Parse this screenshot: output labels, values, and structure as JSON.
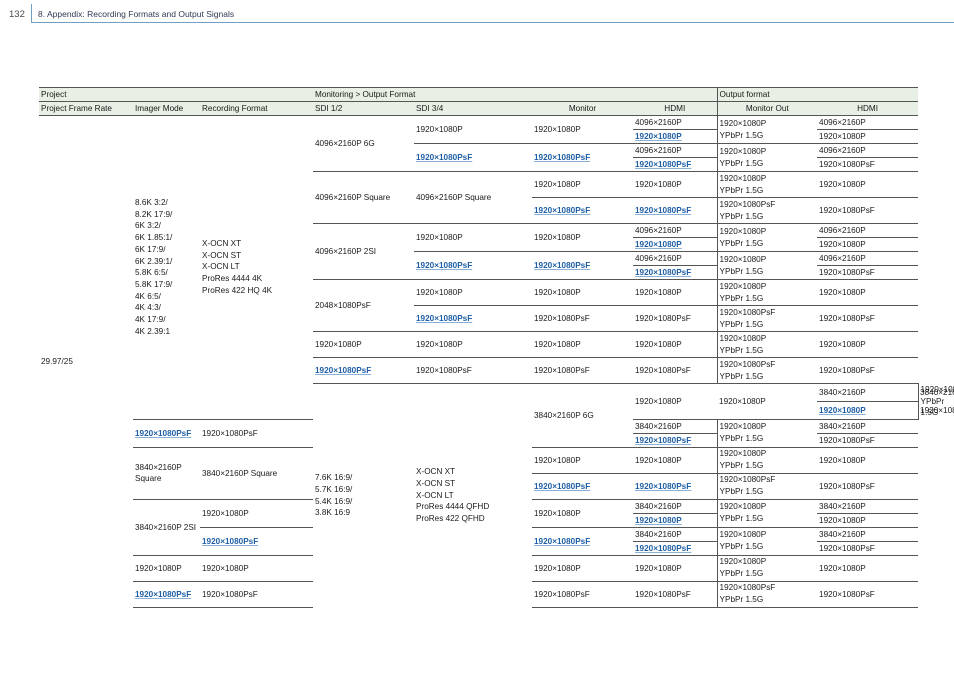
{
  "page_number": "132",
  "section_title": "8. Appendix: Recording Formats and Output Signals",
  "table": {
    "group_headers": {
      "project": "Project",
      "monitoring": "Monitoring > Output Format",
      "output_format": "Output format"
    },
    "columns": {
      "frame_rate": "Project Frame Rate",
      "imager_mode": "Imager Mode",
      "recording_format": "Recording Format",
      "sdi12": "SDI 1/2",
      "sdi34": "SDI 3/4",
      "monitor": "Monitor",
      "hdmi": "HDMI",
      "monitor_out": "Monitor Out",
      "hdmi_out": "HDMI"
    },
    "frame_rate": "29.97/25",
    "group1": {
      "imager_modes": [
        "8.6K 3:2/",
        "8.2K 17:9/",
        "6K 3:2/",
        "6K 1.85:1/",
        "6K 17:9/",
        "6K 2.39:1/",
        "5.8K 6:5/",
        "5.8K 17:9/",
        "4K 6:5/",
        "4K 4:3/",
        "4K 17:9/",
        "4K 2.39:1"
      ],
      "recording_formats": [
        "X-OCN XT",
        "X-OCN ST",
        "X-OCN LT",
        "ProRes 4444 4K",
        "ProRes 422 HQ 4K"
      ]
    },
    "group2": {
      "imager_modes": [
        "7.6K 16:9/",
        "5.7K 16:9/",
        "5.4K 16:9/",
        "3.8K 16:9"
      ],
      "recording_formats": [
        "X-OCN XT",
        "X-OCN ST",
        "X-OCN LT",
        "ProRes 4444 QFHD",
        "ProRes 422 QFHD"
      ]
    },
    "v": {
      "p1080": "1920×1080P",
      "psf1080": "1920×1080PsF",
      "p4096": "4096×2160P",
      "p3840": "3840×2160P",
      "ypbpr": "YPbPr 1.5G",
      "s4096_6g": "4096×2160P 6G",
      "s4096_sq": "4096×2160P Square",
      "s4096_2si": "4096×2160P 2SI",
      "s2048": "2048×1080PsF",
      "s3840_6g": "3840×2160P 6G",
      "s3840_sq": "3840×2160P Square",
      "s3840_2si": "3840×2160P 2SI"
    }
  }
}
